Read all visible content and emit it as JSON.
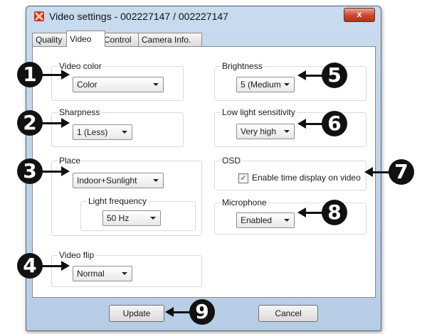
{
  "window": {
    "title": "Video settings - 002227147 / 002227147",
    "close_label": "x"
  },
  "tabs": [
    {
      "label": "Quality",
      "active": false
    },
    {
      "label": "Video",
      "active": true
    },
    {
      "label": "Control",
      "active": false
    },
    {
      "label": "Camera Info.",
      "active": false
    }
  ],
  "video_color": {
    "legend": "Video color",
    "value": "Color"
  },
  "sharpness": {
    "legend": "Sharpness",
    "value": "1 (Less)"
  },
  "place": {
    "legend": "Place",
    "value": "Indoor+Sunlight",
    "light_frequency": {
      "legend": "Light frequency",
      "value": "50 Hz"
    }
  },
  "video_flip": {
    "legend": "Video flip",
    "value": "Normal"
  },
  "brightness": {
    "legend": "Brightness",
    "value": "5 (Medium"
  },
  "low_light": {
    "legend": "Low light sensitivity",
    "value": "Very high"
  },
  "osd": {
    "legend": "OSD",
    "checkbox_label": "Enable time display on video",
    "checked": true
  },
  "microphone": {
    "legend": "Microphone",
    "value": "Enabled"
  },
  "buttons": {
    "update": "Update",
    "cancel": "Cancel"
  },
  "callouts": [
    "1",
    "2",
    "3",
    "4",
    "5",
    "6",
    "7",
    "8",
    "9"
  ]
}
